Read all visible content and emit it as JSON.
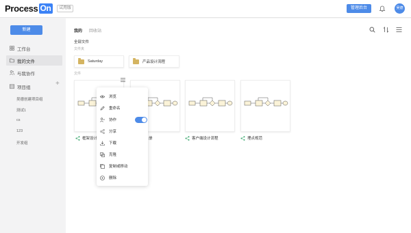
{
  "header": {
    "logo_text": "Process",
    "logo_on": "On",
    "trial_badge": "试用版",
    "admin_button": "管理后台",
    "avatar_text": "吴德"
  },
  "sidebar": {
    "new_button": "新建",
    "items": [
      {
        "label": "工作台",
        "icon": "grid-icon"
      },
      {
        "label": "我的文件",
        "icon": "folder-icon"
      },
      {
        "label": "与我协作",
        "icon": "people-icon"
      },
      {
        "label": "项目组",
        "icon": "project-icon"
      }
    ],
    "project_groups": [
      "吴德创建项目组",
      "测试1",
      "cs",
      "123",
      "开发组"
    ]
  },
  "main": {
    "tabs": [
      {
        "label": "我的"
      },
      {
        "label": "回收站"
      }
    ],
    "all_files": "全部文件",
    "folders_label": "文件夹",
    "folders": [
      "Saturday",
      "产品设计流程"
    ],
    "files_label": "文件",
    "files": [
      {
        "label": "框架设计"
      },
      {
        "label": "册"
      },
      {
        "label": "客户端设计流程"
      },
      {
        "label": "埋点规范"
      }
    ],
    "context_menu": [
      {
        "label": "浏览",
        "icon": "eye-icon"
      },
      {
        "label": "重命名",
        "icon": "pencil-icon"
      },
      {
        "label": "协作",
        "icon": "collab-icon",
        "toggle": true
      },
      {
        "label": "分享",
        "icon": "share-icon"
      },
      {
        "label": "下载",
        "icon": "download-icon"
      },
      {
        "label": "克隆",
        "icon": "clone-icon"
      },
      {
        "label": "复制或移动",
        "icon": "copy-icon"
      },
      {
        "label": "删除",
        "icon": "delete-icon"
      }
    ]
  },
  "colors": {
    "accent": "#4d8be8",
    "folder": "#d4b461",
    "share_green": "#3aa76d"
  }
}
